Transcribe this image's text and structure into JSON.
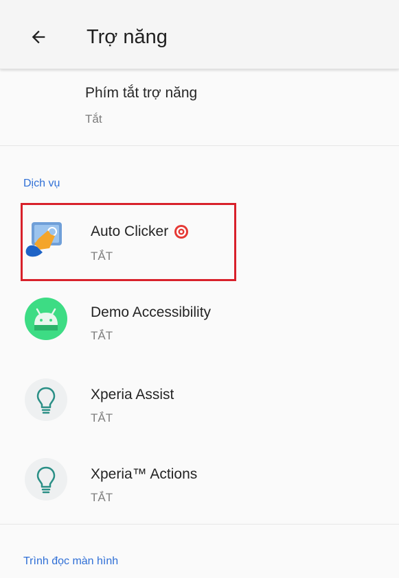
{
  "appbar": {
    "title": "Trợ năng",
    "back_icon": "arrow-back-icon"
  },
  "shortcut": {
    "title": "Phím tắt trợ năng",
    "summary": "Tắt"
  },
  "sections": {
    "services_header": "Dịch vụ",
    "screen_reader_header": "Trình đọc màn hình"
  },
  "services": [
    {
      "name": "Auto Clicker",
      "state": "TẮT",
      "icon": "auto-clicker-app-icon",
      "badge": "target-icon"
    },
    {
      "name": "Demo Accessibility",
      "state": "TẮT",
      "icon": "android-robot-icon"
    },
    {
      "name": "Xperia Assist",
      "state": "TẮT",
      "icon": "lightbulb-icon"
    },
    {
      "name": "Xperia™ Actions",
      "state": "TẮT",
      "icon": "lightbulb-icon"
    }
  ],
  "colors": {
    "accent": "#2f6fd6",
    "highlight": "#d8202a",
    "android_green": "#3ddc84",
    "badge_red": "#e53935"
  }
}
